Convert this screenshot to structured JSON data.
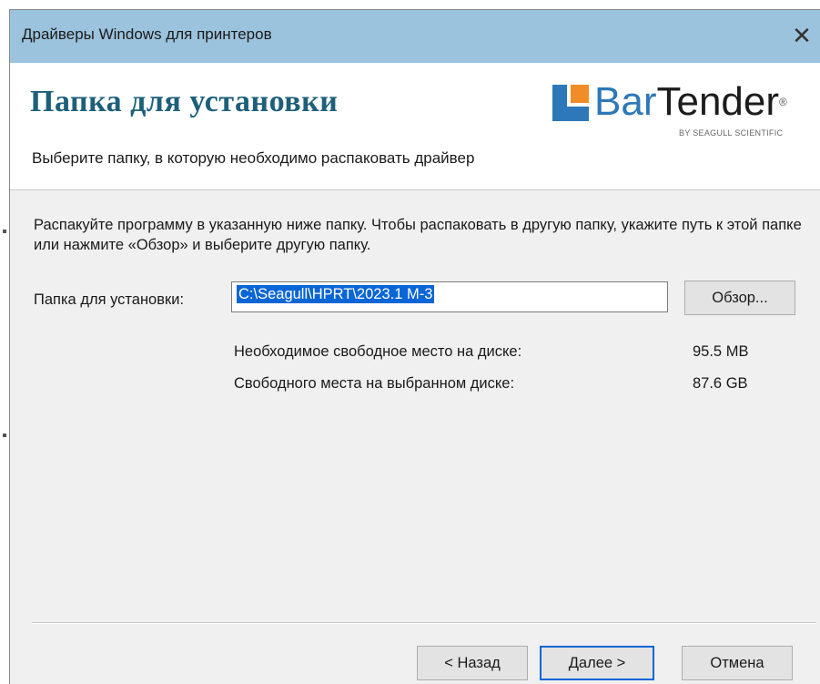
{
  "window": {
    "title": "Драйверы Windows для принтеров",
    "close_glyph": "✕"
  },
  "header": {
    "page_title": "Папка для установки",
    "subtitle": "Выберите папку, в которую необходимо распаковать драйвер",
    "logo": {
      "word_bar": "Bar",
      "word_tender": "Tender",
      "reg_mark": "®",
      "tagline": "BY SEAGULL SCIENTIFIC",
      "icon": "bartender-logo-icon"
    }
  },
  "body": {
    "description": "Распакуйте программу в указанную ниже папку. Чтобы распаковать в другую папку, укажите путь к этой папке или нажмите «Обзор» и выберите  другую папку.",
    "folder_label": "Папка для установки:",
    "folder_value": "C:\\Seagull\\HPRT\\2023.1 M-3",
    "browse_label": "Обзор...",
    "required_label": "Необходимое свободное место на диске:",
    "required_value": "95.5 MB",
    "available_label": "Свободного места на выбранном диске:",
    "available_value": "87.6 GB"
  },
  "footer": {
    "back_label": "< Назад",
    "next_label": "Далее >",
    "cancel_label": "Отмена"
  },
  "colors": {
    "titlebar": "#9cc3dd",
    "page_title": "#1e5f7a",
    "logo_blue": "#2c78b8",
    "logo_orange": "#f28c28",
    "selection": "#0a66d6"
  }
}
